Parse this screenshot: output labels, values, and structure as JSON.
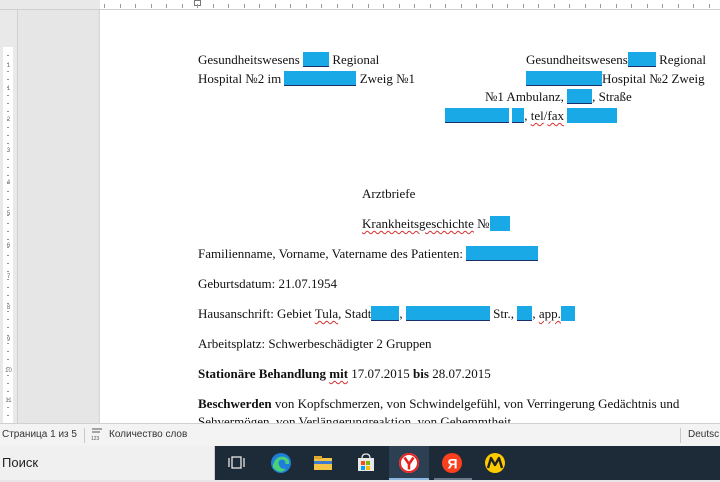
{
  "document": {
    "header_left": {
      "line1_a": "Gesundheitswesens",
      "line1_b": "Regional",
      "line2_a": "Hospital №2 im",
      "line2_b": "Zweig №1"
    },
    "header_right": {
      "line1_a": "Gesundheitswesens",
      "line1_b": "Regional",
      "line2_b": "Hospital №2 Zweig",
      "line3_a": "№1 Ambulanz,",
      "line3_b": ", Straße",
      "line4_comma": ",",
      "line4_tel": "tel",
      "line4_slash": "/",
      "line4_fax": "fax"
    },
    "title": "Arztbriefe",
    "history_label": "Krankheitsgeschichte",
    "history_no": "№",
    "patient_name_label": "Familienname, Vorname, Vatername des Patienten:",
    "birth_date": "Geburtsdatum: 21.07.1954",
    "address": {
      "prefix": "Hausanschrift: Gebiet",
      "tula": "Tula",
      "comma1": ",",
      "stadt": "Stadt",
      "comma2": ",",
      "str": "Str.,",
      "comma3": ",",
      "app": "app."
    },
    "workplace": "Arbeitsplatz: Schwerbeschädigter 2 Gruppen",
    "treatment": {
      "label": "Stationäre Behandlung",
      "mit": "mit",
      "from": "17.07.2015",
      "bis": "bis",
      "to": "28.07.2015"
    },
    "complaints": {
      "label": "Beschwerden",
      "text": "von Kopfschmerzen, von Schwindelgefühl, von Verringerung Gedächtnis und",
      "text2": "Sehvermögen, von Verlängerungreaktion, von Gehemmtheit"
    }
  },
  "ruler": {
    "numbers": [
      "1",
      "1",
      "2",
      "3",
      "4",
      "5",
      "6",
      "7",
      "8",
      "9",
      "10",
      "11"
    ]
  },
  "statusbar": {
    "page": "Страница 1 из 5",
    "words": "Количество слов",
    "language": "Deutsc"
  },
  "taskbar": {
    "search_placeholder": "Поиск",
    "icons": [
      "task-view-icon",
      "edge-icon",
      "file-explorer-icon",
      "store-icon",
      "yandex-browser-icon",
      "yandex-icon",
      "yandex-market-icon"
    ]
  },
  "colors": {
    "redaction": "#18a9e6",
    "taskbar": "#1d2a38"
  }
}
